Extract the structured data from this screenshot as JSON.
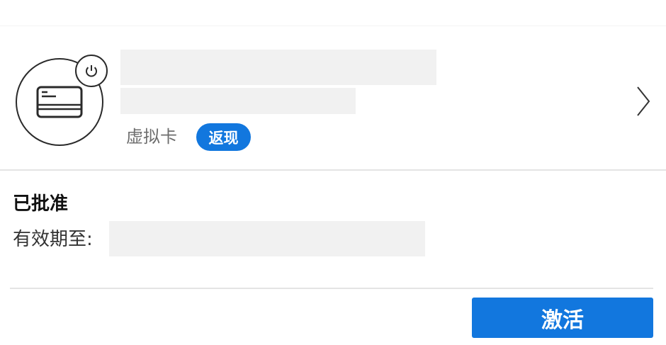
{
  "card": {
    "name": "",
    "number": "",
    "type_label": "虚拟卡",
    "cashback_badge": "返现",
    "accent_color": "#1277de"
  },
  "status": {
    "title": "已批准",
    "expiry_label": "有效期至:",
    "expiry_value": ""
  },
  "actions": {
    "activate_label": "激活"
  },
  "icons": {
    "card": "credit-card-icon",
    "power": "power-icon",
    "chevron": "chevron-right-icon"
  }
}
